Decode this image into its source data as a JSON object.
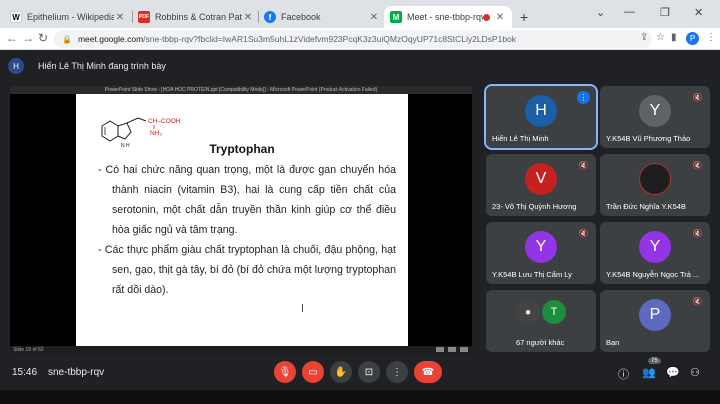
{
  "browser": {
    "tabs": [
      {
        "favicon": "W",
        "favicon_color": "#ffffff",
        "favicon_text_color": "#000000",
        "title": "Epithelium - Wikipedia",
        "active": false
      },
      {
        "favicon": "PDF",
        "favicon_color": "#d93025",
        "favicon_text_color": "#ffffff",
        "title": "Robbins & Cotran Pathologic Ba",
        "active": false
      },
      {
        "favicon": "f",
        "favicon_color": "#1877f2",
        "favicon_text_color": "#ffffff",
        "title": "Facebook",
        "active": false
      },
      {
        "favicon": "M",
        "favicon_color": "#00ac47",
        "favicon_text_color": "#ffffff",
        "title": "Meet - sne-tbbp-rqv",
        "active": true
      }
    ],
    "url_host": "meet.google.com",
    "url_rest": "/sne-tbbp-rqv?fbclid=IwAR1Su3m5uhL1zVidefvm923PcqK3z3uiQMzOqyUP71c8StCLiy2LDsP1bok",
    "profile_initial": "P"
  },
  "presenter": {
    "initial": "H",
    "text": "Hiển Lê Thị Minh đang trình bày"
  },
  "slide": {
    "window_title": "PowerPoint Slide Show - [HOA HOC PROTEIN.ppt [Compatibility Mode]] - Microsoft PowerPoint (Product Activation Failed)",
    "chem_label_1": "CH–COOH",
    "chem_label_2": "NH₂",
    "chem_nh": "N H",
    "title": "Tryptophan",
    "bullets": [
      "- Có hai chức năng quan trọng, một là được gan chuyển hóa thành niacin (vitamin B3), hai là cung cấp tiền chất của serotonin, một chất dẫn truyền thần kinh giúp cơ thể điều hòa giấc ngủ và tâm trạng.",
      "- Các thực phẩm giàu chất tryptophan là chuối, đậu phộng, hạt sen, gạo, thịt gà tây, bí đỏ (bí đỏ chứa một lượng tryptophan rất dồi dào)."
    ],
    "status": "Slide 19 of 62"
  },
  "participants": [
    {
      "initial": "H",
      "color": "#1a5fa8",
      "name": "Hiển Lê Thị Minh",
      "mic": "on"
    },
    {
      "initial": "Y",
      "color": "#5f6368",
      "name": "Y.K54B Vũ Phương Thảo",
      "mic": "off"
    },
    {
      "initial": "V",
      "color": "#c5221f",
      "name": "23- Võ Thị Quỳnh Hương",
      "mic": "off"
    },
    {
      "initial": "",
      "color": "#1e1e1e",
      "name": "Trần Đức Nghĩa Y.K54B",
      "mic": "off"
    },
    {
      "initial": "Y",
      "color": "#9334e6",
      "name": "Y.K54B Lưu Thị Cẩm Ly",
      "mic": "off"
    },
    {
      "initial": "Y",
      "color": "#9334e6",
      "name": "Y.K54B Nguyễn Ngọc Trà ...",
      "mic": "off"
    },
    {
      "initial": "T",
      "color": "#1e8e3e",
      "name": "67 người khác",
      "mic": "none"
    },
    {
      "initial": "P",
      "color": "#5c6bc0",
      "name": "Bạn",
      "mic": "off"
    }
  ],
  "meeting": {
    "time": "15:46",
    "code": "sne-tbbp-rqv",
    "participant_count": "75"
  },
  "colors": {
    "accent": "#8ab4f8",
    "danger": "#ea4335",
    "chem_red": "#c5221f"
  }
}
